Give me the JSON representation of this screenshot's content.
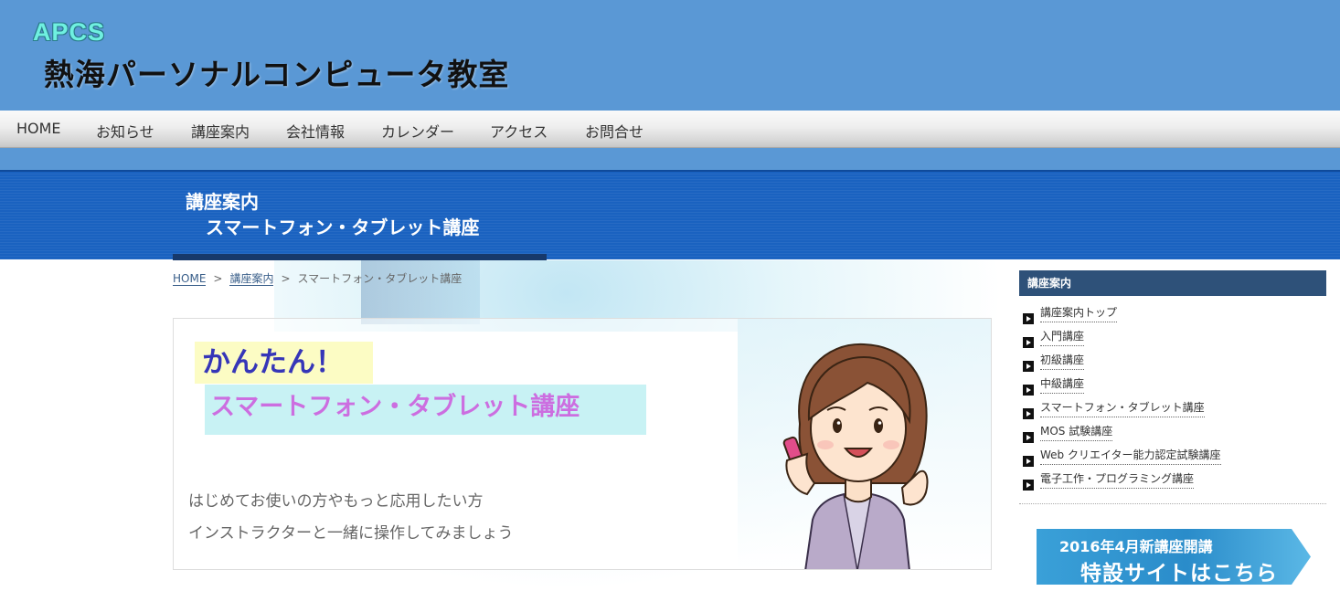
{
  "header": {
    "logo_text": "APCS",
    "site_title": "熱海パーソナルコンピュータ教室"
  },
  "nav": {
    "items": [
      {
        "label": "HOME"
      },
      {
        "label": "お知らせ"
      },
      {
        "label": "講座案内"
      },
      {
        "label": "会社情報"
      },
      {
        "label": "カレンダー"
      },
      {
        "label": "アクセス"
      },
      {
        "label": "お問合せ"
      }
    ]
  },
  "banner": {
    "title_line1": "講座案内",
    "title_line2": "スマートフォン・タブレット講座"
  },
  "breadcrumb": {
    "home": "HOME",
    "separator": ">",
    "category": "講座案内",
    "current": "スマートフォン・タブレット講座"
  },
  "content": {
    "catch": "かんたん！",
    "title": "スマートフォン・タブレット講座",
    "desc_line1": "はじめてお使いの方やもっと応用したい方",
    "desc_line2": "インストラクターと一緒に操作してみましょう"
  },
  "sidebar": {
    "heading": "講座案内",
    "items": [
      {
        "label": "講座案内トップ"
      },
      {
        "label": "入門講座"
      },
      {
        "label": "初級講座"
      },
      {
        "label": "中級講座"
      },
      {
        "label": "スマートフォン・タブレット講座"
      },
      {
        "label": "MOS 試験講座"
      },
      {
        "label": "Web クリエイター能力認定試験講座"
      },
      {
        "label": "電子工作・プログラミング講座"
      }
    ]
  },
  "promo": {
    "line1": "2016年4月新講座開講",
    "line2": "特設サイトはこちら"
  },
  "colors": {
    "header_bg": "#5a98d5",
    "banner_bg": "#1a62c0",
    "sidebar_heading_bg": "#2e5179",
    "catch_text": "#3636b8",
    "course_title_text": "#cc6ee0"
  },
  "icons": {
    "sidebar_bullet": "play-arrow-icon",
    "illustration": "woman-on-phone-illustration"
  }
}
